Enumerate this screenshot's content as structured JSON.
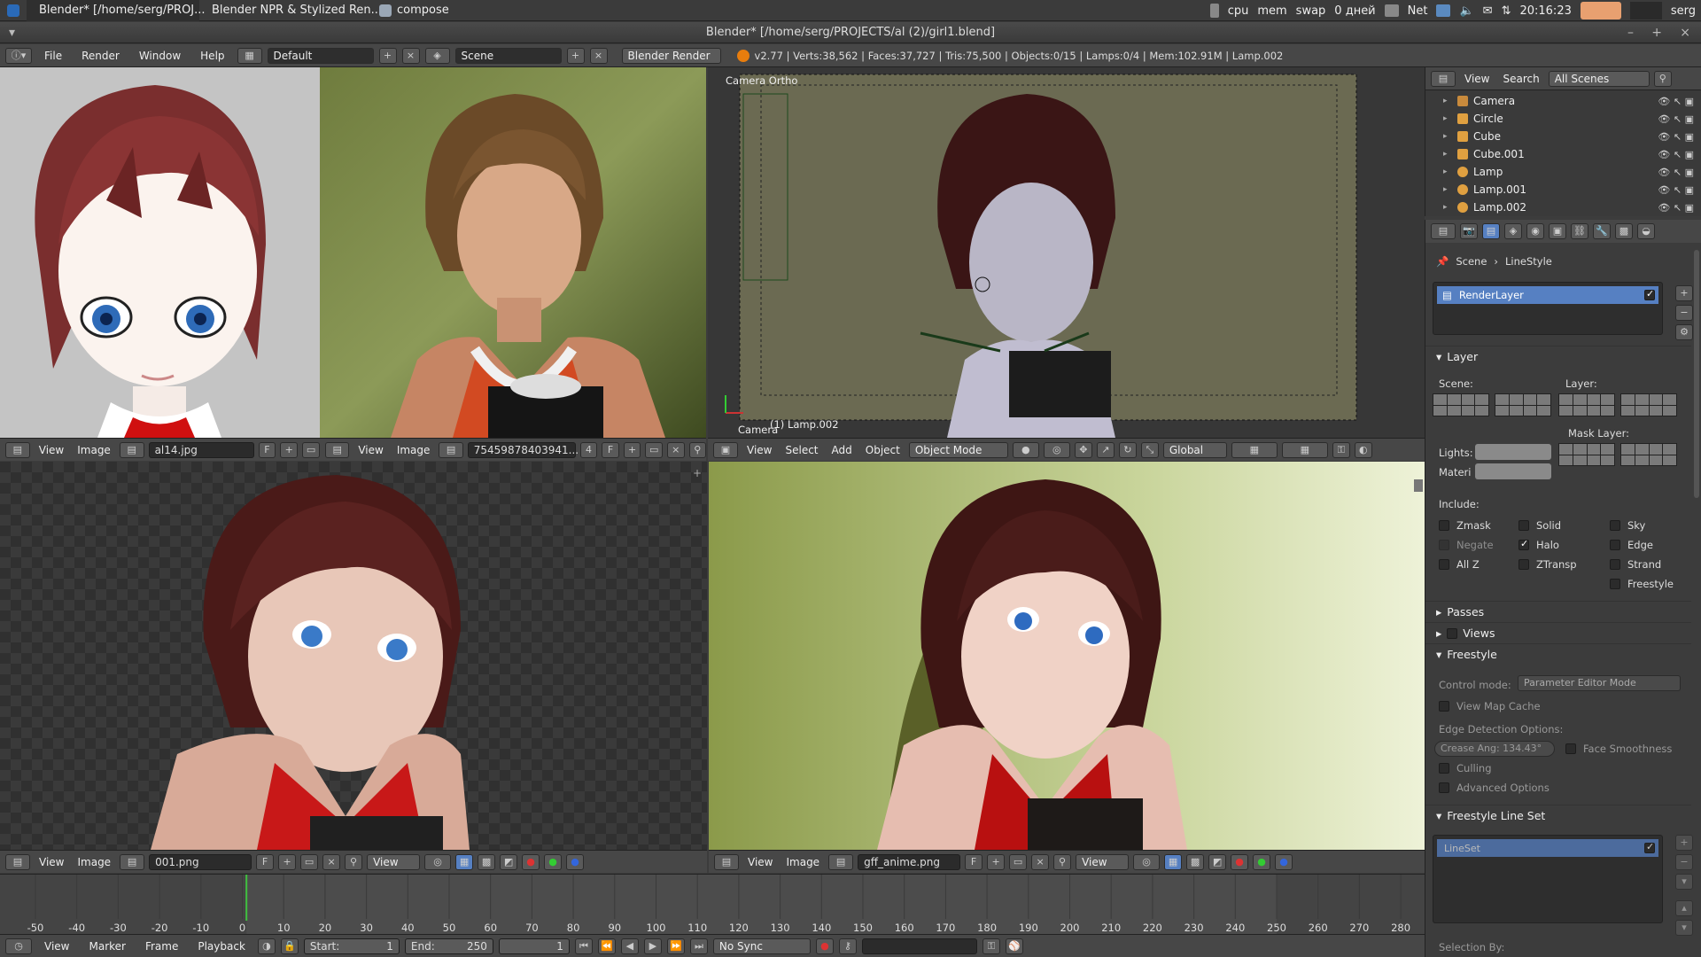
{
  "os": {
    "tasks": [
      {
        "label": "Blender* [/home/serg/PROJ..."
      },
      {
        "label": "Blender NPR & Stylized Ren..."
      },
      {
        "label": "compose"
      }
    ],
    "indicators": {
      "cpu": "cpu",
      "mem": "mem",
      "swap": "swap",
      "days": "0 дней",
      "net": "Net",
      "time": "20:16:23",
      "user": "serg"
    }
  },
  "window": {
    "title": "Blender* [/home/serg/PROJECTS/al (2)/girl1.blend]"
  },
  "info_header": {
    "menus": [
      "File",
      "Render",
      "Window",
      "Help"
    ],
    "layout": "Default",
    "scene": "Scene",
    "engine": "Blender Render",
    "stats": "v2.77 | Verts:38,562 | Faces:37,727 | Tris:75,500 | Objects:0/15 | Lamps:0/4 | Mem:102.91M | Lamp.002"
  },
  "image_editor_1": {
    "menus": [
      "View",
      "Image"
    ],
    "file": "al14.jpg",
    "f_label": "F"
  },
  "image_editor_2": {
    "menus": [
      "View",
      "Image"
    ],
    "file": "75459878403941...",
    "users": "4",
    "f_label": "F"
  },
  "viewport_3d": {
    "overlay_title": "Camera Ortho",
    "overlay_object": "(1) Lamp.002",
    "camera_label": "Camera",
    "menus": [
      "View",
      "Select",
      "Add",
      "Object"
    ],
    "mode": "Object Mode",
    "orientation": "Global"
  },
  "image_editor_3": {
    "menus": [
      "View",
      "Image"
    ],
    "file": "001.png",
    "f_label": "F",
    "view_label": "View"
  },
  "image_editor_4": {
    "menus": [
      "View",
      "Image"
    ],
    "file": "gff_anime.png",
    "f_label": "F",
    "view_label": "View"
  },
  "outliner": {
    "menus": [
      "View",
      "Search"
    ],
    "scene_filter": "All Scenes",
    "items": [
      {
        "name": "Camera",
        "color": "#c88a3c"
      },
      {
        "name": "Circle",
        "color": "#e0a040"
      },
      {
        "name": "Cube",
        "color": "#e0a040"
      },
      {
        "name": "Cube.001",
        "color": "#e0a040"
      },
      {
        "name": "Lamp",
        "color": "#e0a040"
      },
      {
        "name": "Lamp.001",
        "color": "#e0a040"
      },
      {
        "name": "Lamp.002",
        "color": "#e0a040"
      }
    ]
  },
  "properties": {
    "breadcrumb": {
      "scene": "Scene",
      "linestyle": "LineStyle"
    },
    "render_layer": "RenderLayer",
    "layer_section": {
      "title": "Layer",
      "scene_label": "Scene:",
      "layer_label": "Layer:",
      "mask_label": "Mask Layer:",
      "lights_label": "Lights:",
      "materi_label": "Materi",
      "include_label": "Include:",
      "checks": [
        {
          "label": "Zmask",
          "checked": false
        },
        {
          "label": "Negate",
          "checked": false
        },
        {
          "label": "All Z",
          "checked": false
        },
        {
          "label": "Solid",
          "checked": false
        },
        {
          "label": "Halo",
          "checked": true
        },
        {
          "label": "ZTransp",
          "checked": false
        },
        {
          "label": "Sky",
          "checked": false
        },
        {
          "label": "Edge",
          "checked": false
        },
        {
          "label": "Strand",
          "checked": false
        },
        {
          "label": "Freestyle",
          "checked": false
        }
      ]
    },
    "passes_title": "Passes",
    "views_title": "Views",
    "freestyle": {
      "title": "Freestyle",
      "control_mode_label": "Control mode:",
      "control_mode": "Parameter Editor Mode",
      "view_map_cache": "View Map Cache",
      "edge_detection": "Edge Detection Options:",
      "crease_angle": "Crease Ang: 134.43°",
      "face_smoothness": "Face Smoothness",
      "culling": "Culling",
      "advanced": "Advanced Options"
    },
    "lineset_section": {
      "title": "Freestyle Line Set",
      "item": "LineSet",
      "selection_by": "Selection By:"
    }
  },
  "timeline": {
    "ticks": [
      "-50",
      "-40",
      "-30",
      "-20",
      "-10",
      "0",
      "10",
      "20",
      "30",
      "40",
      "50",
      "60",
      "70",
      "80",
      "90",
      "100",
      "110",
      "120",
      "130",
      "140",
      "150",
      "160",
      "170",
      "180",
      "190",
      "200",
      "210",
      "220",
      "230",
      "240",
      "250",
      "260",
      "270",
      "280"
    ],
    "current_frame": 1,
    "menus": [
      "View",
      "Marker",
      "Frame",
      "Playback"
    ],
    "start": "Start:",
    "start_val": "1",
    "end": "End:",
    "end_val": "250",
    "frame_val": "1",
    "sync": "No Sync"
  }
}
